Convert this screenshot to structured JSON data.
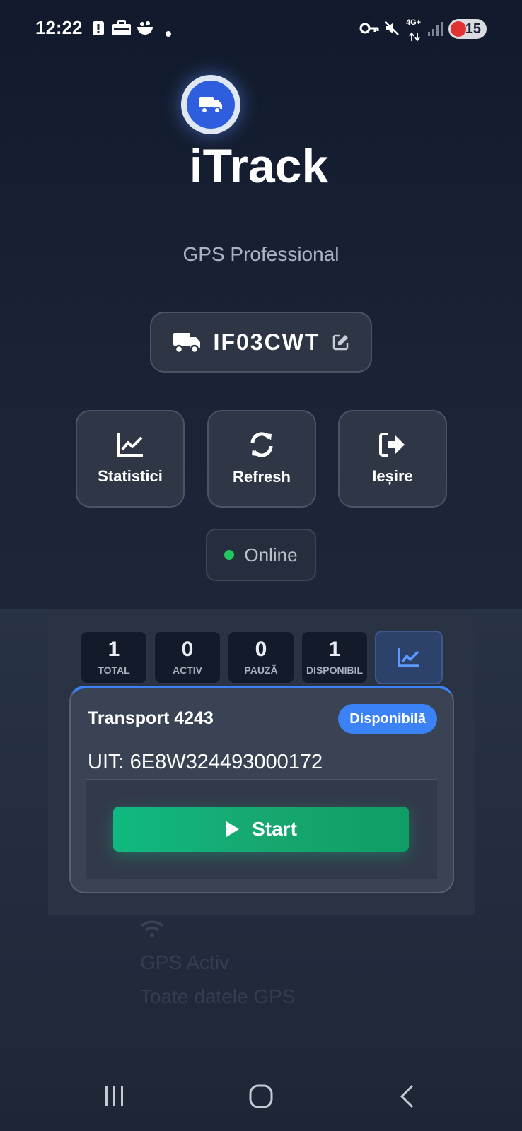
{
  "status_bar": {
    "time": "12:22",
    "network": "4G+",
    "battery": "15"
  },
  "app": {
    "title": "iTrack",
    "subtitle": "GPS Professional",
    "accent": "#3b82f6"
  },
  "vehicle": {
    "plate": "IF03CWT"
  },
  "actions": [
    {
      "label": "Statistici",
      "icon": "chart-line-icon"
    },
    {
      "label": "Refresh",
      "icon": "sync-icon"
    },
    {
      "label": "Ieșire",
      "icon": "sign-out-icon"
    }
  ],
  "connection": {
    "status": "Online",
    "color": "#22c55e"
  },
  "stats": [
    {
      "value": "1",
      "label": "TOTAL"
    },
    {
      "value": "0",
      "label": "ACTIV"
    },
    {
      "value": "0",
      "label": "PAUZĂ"
    },
    {
      "value": "1",
      "label": "DISPONIBIL"
    }
  ],
  "transport": {
    "title": "Transport 4243",
    "status": "Disponibilă",
    "uit": "UIT: 6E8W324493000172",
    "start_label": "Start"
  },
  "background": {
    "gps_text": "GPS Activ",
    "toate_text": "Toate datele GPS"
  }
}
